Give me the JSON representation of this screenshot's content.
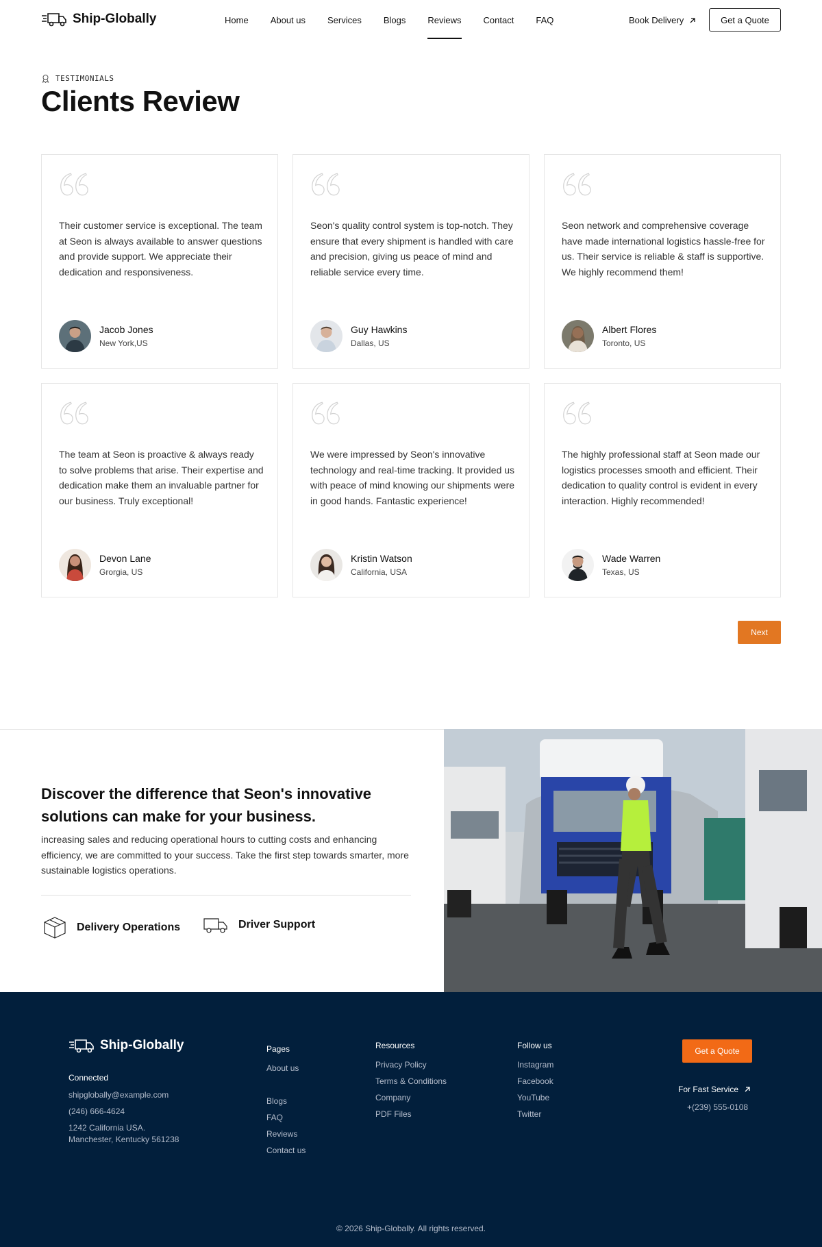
{
  "header": {
    "brand": "Ship-Globally",
    "nav": [
      "Home",
      "About us",
      "Services",
      "Blogs",
      "Reviews",
      "Contact",
      "FAQ"
    ],
    "active_nav": "Reviews",
    "book_label": "Book Delivery",
    "quote_label": "Get a Quote"
  },
  "section": {
    "eyebrow": "TESTIMONIALS",
    "title": "Clients Review"
  },
  "reviews": [
    {
      "text": "Their customer service is exceptional. The team at Seon is always available to answer questions and provide support. We appreciate their dedication and responsiveness.",
      "name": "Jacob Jones",
      "location": "New York,US"
    },
    {
      "text": "Seon's quality control system is top-notch. They ensure that every shipment is handled with care and precision, giving us peace of mind and reliable service every time.",
      "name": "Guy Hawkins",
      "location": "Dallas, US"
    },
    {
      "text": "Seon network and comprehensive coverage have made international logistics hassle-free for us. Their service is reliable & staff is supportive. We highly recommend them!",
      "name": "Albert Flores",
      "location": "Toronto, US"
    },
    {
      "text": "The team at Seon is proactive & always ready to solve problems that arise. Their expertise and dedication make them an invaluable partner for our business. Truly exceptional!",
      "name": "Devon Lane",
      "location": "Grorgia, US"
    },
    {
      "text": "We were impressed by Seon's innovative technology and real-time tracking. It provided us with peace of mind knowing our shipments were in good hands. Fantastic experience!",
      "name": "Kristin Watson",
      "location": "California, USA"
    },
    {
      "text": "The highly professional staff at Seon made our logistics processes smooth and efficient. Their dedication to quality control is evident in every interaction. Highly recommended!",
      "name": "Wade Warren",
      "location": "Texas, US"
    }
  ],
  "pager": {
    "next_label": "Next"
  },
  "discover": {
    "title": "Discover the difference that Seon's innovative solutions can make for your business.",
    "text": "increasing sales and reducing operational hours to cutting costs and enhancing efficiency, we are committed to your success. Take the first step towards smarter, more sustainable logistics operations.",
    "features": [
      "Delivery Operations",
      "Driver Support"
    ]
  },
  "footer": {
    "brand": "Ship-Globally",
    "connected_heading": "Connected",
    "email": "shipglobally@example.com",
    "phone": "(246) 666-4624",
    "address_line1": "1242 California USA.",
    "address_line2": "Manchester, Kentucky 561238",
    "pages_heading": "Pages",
    "pages": [
      "About us",
      "Blogs",
      "FAQ",
      "Reviews",
      "Contact us"
    ],
    "resources_heading": "Resources",
    "resources": [
      "Privacy Policy",
      "Terms & Conditions",
      "Company",
      "PDF Files"
    ],
    "follow_heading": "Follow us",
    "follow": [
      "Instagram",
      "Facebook",
      "YouTube",
      "Twitter"
    ],
    "quote_label": "Get a Quote",
    "fast_service_label": "For Fast Service",
    "fast_service_phone": "+(239) 555-0108",
    "copyright": "© 2026 Ship-Globally. All rights reserved."
  },
  "colors": {
    "accent": "#e27722",
    "footer_bg": "#021f3c",
    "footer_quote": "#f26a16"
  }
}
